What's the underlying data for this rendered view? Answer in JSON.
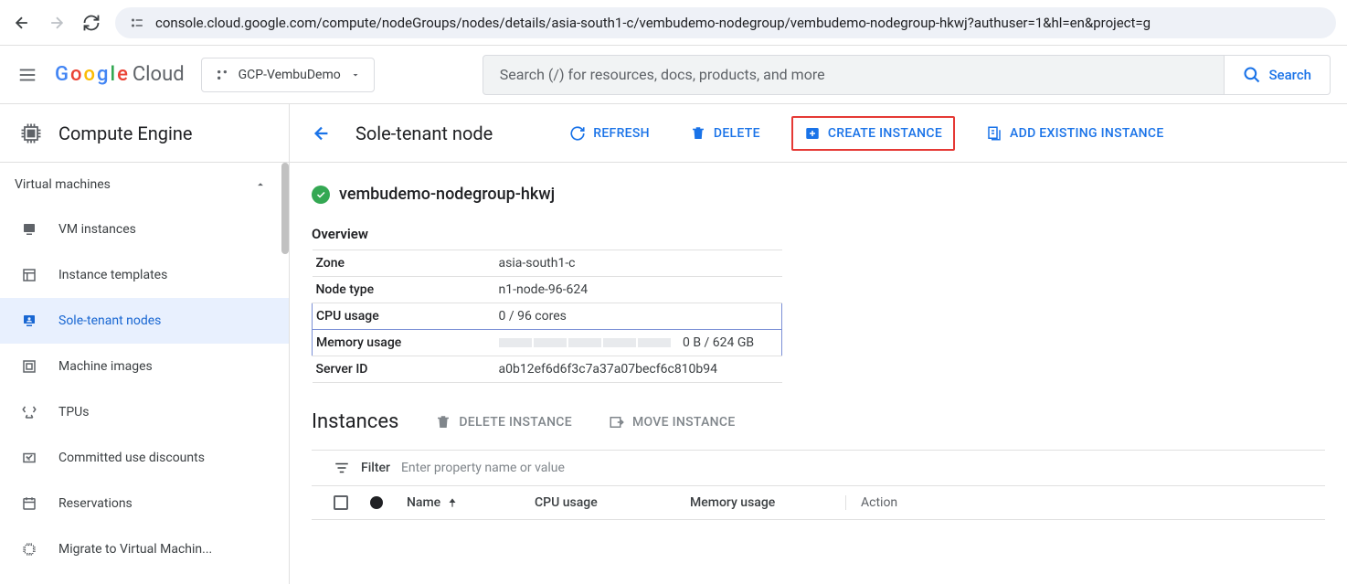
{
  "browser": {
    "url": "console.cloud.google.com/compute/nodeGroups/nodes/details/asia-south1-c/vembudemo-nodegroup/vembudemo-nodegroup-hkwj?authuser=1&hl=en&project=g"
  },
  "header": {
    "logo_cloud": "Cloud",
    "project_name": "GCP-VembuDemo",
    "search_placeholder": "Search (/) for resources, docs, products, and more",
    "search_button": "Search"
  },
  "sidebar": {
    "title": "Compute Engine",
    "section": "Virtual machines",
    "items": [
      {
        "label": "VM instances"
      },
      {
        "label": "Instance templates"
      },
      {
        "label": "Sole-tenant nodes"
      },
      {
        "label": "Machine images"
      },
      {
        "label": "TPUs"
      },
      {
        "label": "Committed use discounts"
      },
      {
        "label": "Reservations"
      },
      {
        "label": "Migrate to Virtual Machin..."
      }
    ]
  },
  "actionbar": {
    "page_title": "Sole-tenant node",
    "refresh": "REFRESH",
    "delete": "DELETE",
    "create_instance": "CREATE INSTANCE",
    "add_existing": "ADD EXISTING INSTANCE"
  },
  "node": {
    "name": "vembudemo-nodegroup-hkwj",
    "overview_title": "Overview",
    "rows": {
      "zone_label": "Zone",
      "zone_value": "asia-south1-c",
      "node_type_label": "Node type",
      "node_type_value": "n1-node-96-624",
      "cpu_label": "CPU usage",
      "cpu_value": "0 / 96 cores",
      "mem_label": "Memory usage",
      "mem_value": "0 B / 624 GB",
      "server_label": "Server ID",
      "server_value": "a0b12ef6d6f3c7a37a07becf6c810b94"
    }
  },
  "instances": {
    "title": "Instances",
    "delete_instance": "DELETE INSTANCE",
    "move_instance": "MOVE INSTANCE",
    "filter_label": "Filter",
    "filter_placeholder": "Enter property name or value",
    "columns": {
      "name": "Name",
      "cpu": "CPU usage",
      "memory": "Memory usage",
      "action": "Action"
    }
  }
}
